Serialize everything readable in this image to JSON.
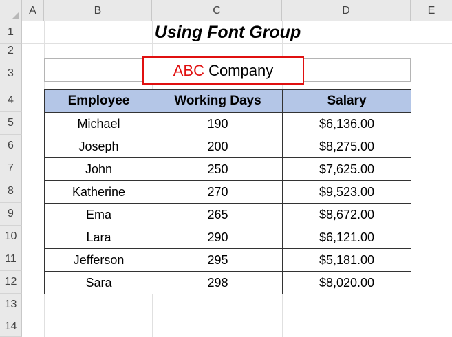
{
  "columns": [
    "A",
    "B",
    "C",
    "D",
    "E"
  ],
  "rows": [
    "1",
    "2",
    "3",
    "4",
    "5",
    "6",
    "7",
    "8",
    "9",
    "10",
    "11",
    "12",
    "13",
    "14"
  ],
  "title": "Using Font Group",
  "company": {
    "part1": "ABC",
    "part2": " Company",
    "highlight_color": "#e01010"
  },
  "table": {
    "headers": [
      "Employee",
      "Working Days",
      "Salary"
    ],
    "rows": [
      [
        "Michael",
        "190",
        "$6,136.00"
      ],
      [
        "Joseph",
        "200",
        "$8,275.00"
      ],
      [
        "John",
        "250",
        "$7,625.00"
      ],
      [
        "Katherine",
        "270",
        "$9,523.00"
      ],
      [
        "Ema",
        "265",
        "$8,672.00"
      ],
      [
        "Lara",
        "290",
        "$6,121.00"
      ],
      [
        "Jefferson",
        "295",
        "$5,181.00"
      ],
      [
        "Sara",
        "298",
        "$8,020.00"
      ]
    ],
    "header_fill": "#b4c6e7"
  }
}
